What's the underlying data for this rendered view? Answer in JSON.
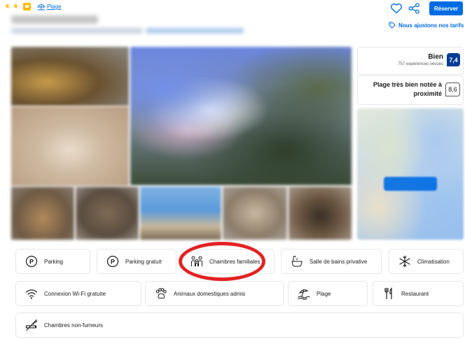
{
  "header": {
    "stars": [
      "★",
      "★"
    ],
    "beach_tag": "Plage",
    "reserve_label": "Réserver",
    "price_match": "Nous ajustons nos tarifs"
  },
  "icons": {
    "heart": "heart-icon",
    "share": "share-icon",
    "tag": "tag-icon"
  },
  "reviews": {
    "word": "Bien",
    "count_label": "757 expériences vécues",
    "score": "7,4"
  },
  "beach_rating": {
    "label": "Plage très bien notée à proximité",
    "score": "8,6"
  },
  "facilities": [
    {
      "label": "Parking",
      "icon": "parking-icon"
    },
    {
      "label": "Parking gratuit",
      "icon": "parking-icon"
    },
    {
      "label": "Chambres familiales",
      "icon": "family-icon"
    },
    {
      "label": "Salle de bains privative",
      "icon": "bathtub-icon"
    },
    {
      "label": "Climatisation",
      "icon": "snowflake-icon"
    },
    {
      "label": "Connexion Wi-Fi gratuite",
      "icon": "wifi-icon"
    },
    {
      "label": "Animaux domestiques admis",
      "icon": "paw-icon"
    },
    {
      "label": "Plage",
      "icon": "beach-icon"
    },
    {
      "label": "Restaurant",
      "icon": "restaurant-icon"
    },
    {
      "label": "Chambres non-fumeurs",
      "icon": "no-smoking-icon"
    }
  ],
  "colors": {
    "brand_blue": "#006ce4",
    "score_navy": "#003b95",
    "star_yellow": "#febb02",
    "highlight_red": "#e32222"
  }
}
